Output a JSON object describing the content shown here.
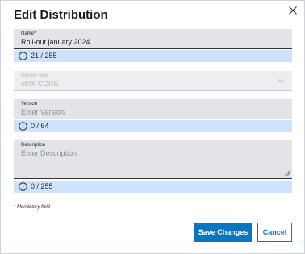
{
  "dialog": {
    "title": "Edit Distribution",
    "close_icon": "close-icon"
  },
  "name_field": {
    "label": "Name*",
    "value": "Roll-out january 2024",
    "counter": "21 / 255"
  },
  "device_type_field": {
    "label": "Device Type",
    "value": "ctrlX CORE",
    "icon": "chevron-down-icon"
  },
  "version_field": {
    "label": "Version",
    "placeholder": "Enter Version",
    "counter": "0 / 64"
  },
  "description_field": {
    "label": "Description",
    "placeholder": "Enter Description",
    "counter": "0 / 255"
  },
  "mandatory_note": "* Mandatory field",
  "actions": {
    "save_label": "Save Changes",
    "cancel_label": "Cancel"
  },
  "colors": {
    "primary": "#0a76c0",
    "counter_bg": "#cfe2fb",
    "field_bg": "#e2e4e8"
  }
}
